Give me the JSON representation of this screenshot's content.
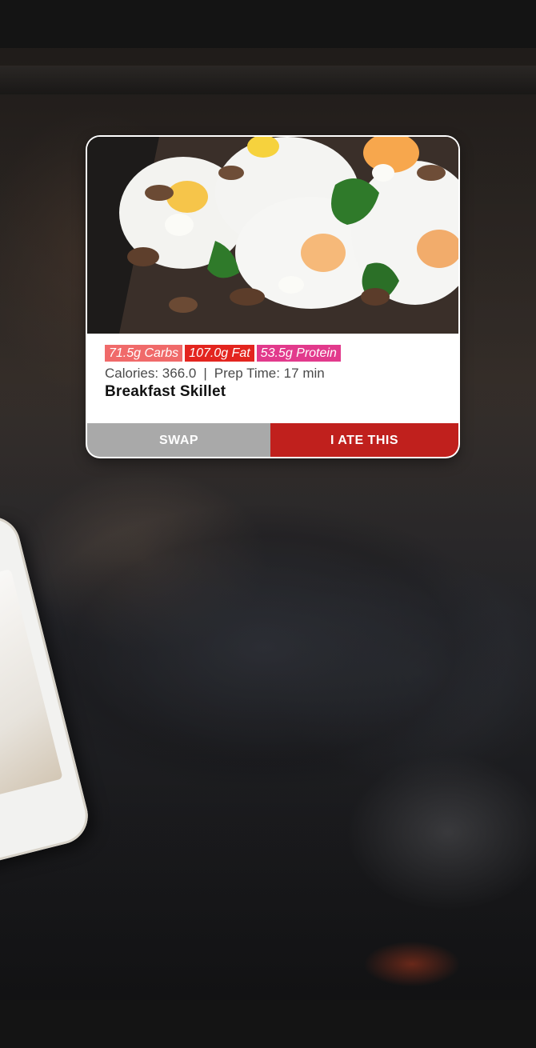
{
  "meal_card": {
    "image_alt": "Breakfast Skillet",
    "macros": {
      "carbs": "71.5g Carbs",
      "fat": "107.0g Fat",
      "protein": "53.5g Protein"
    },
    "calories": "Calories: 366.0",
    "separator": "|",
    "prep_time": "Prep Time: 17 min",
    "title": "Breakfast Skillet",
    "swap_label": "SWAP",
    "ate_label": "I ATE THIS"
  },
  "colors": {
    "carbs": "#f06a6a",
    "fat": "#e3251f",
    "protein": "#e23a8c",
    "swap_button": "#a9a9a9",
    "ate_button": "#c0201d"
  }
}
